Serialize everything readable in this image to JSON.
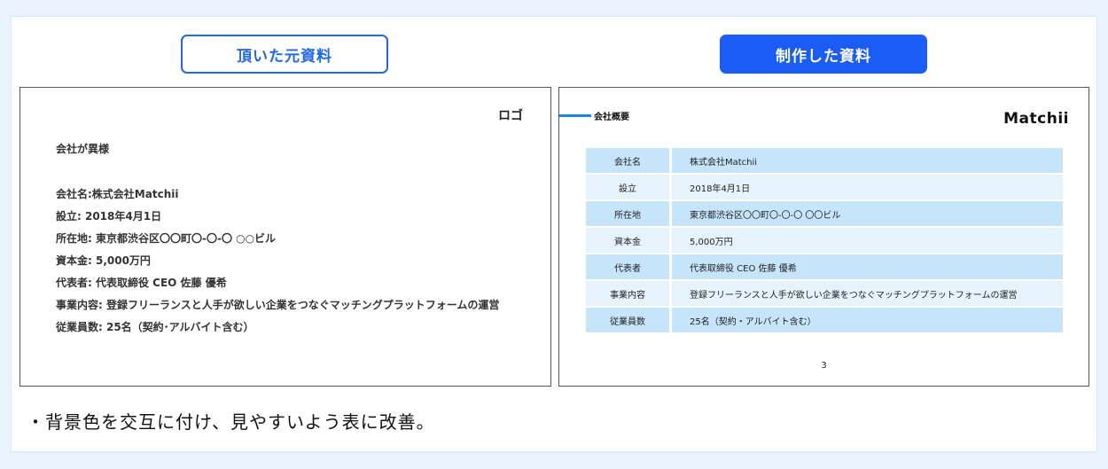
{
  "labels": {
    "original": "頂いた元資料",
    "made": "制作した資料"
  },
  "original_slide": {
    "logo": "ロゴ",
    "heading": "会社が異様",
    "lines": [
      "会社名:株式会社Matchii",
      "設立: 2018年4月1日",
      "所在地: 東京都渋谷区〇〇町〇-〇-〇 ○○ビル",
      "資本金: 5,000万円",
      "代表者: 代表取締役 CEO 佐藤 優希",
      "事業内容: 登録フリーランスと人手が欲しい企業をつなぐマッチングプラットフォームの運営",
      "従業員数: 25名（契約･アルバイト含む）"
    ]
  },
  "made_slide": {
    "section_title": "会社概要",
    "brand": "Matchii",
    "rows": [
      {
        "key": "会社名",
        "value": "株式会社Matchii"
      },
      {
        "key": "設立",
        "value": "2018年4月1日"
      },
      {
        "key": "所在地",
        "value": "東京都渋谷区〇〇町〇-〇-〇 〇〇ビル"
      },
      {
        "key": "資本金",
        "value": "5,000万円"
      },
      {
        "key": "代表者",
        "value": "代表取締役 CEO 佐藤 優希"
      },
      {
        "key": "事業内容",
        "value": "登録フリーランスと人手が欲しい企業をつなぐマッチングプラットフォームの運営"
      },
      {
        "key": "従業員数",
        "value": "25名（契約・アルバイト含む）"
      }
    ],
    "page_number": "3"
  },
  "note": "・背景色を交互に付け、見やすいよう表に改善。",
  "colors": {
    "accent": "#1a5cf5",
    "row_dark": "#c6e4fa",
    "row_light": "#e6f3fd",
    "background": "#e8f3fd"
  }
}
